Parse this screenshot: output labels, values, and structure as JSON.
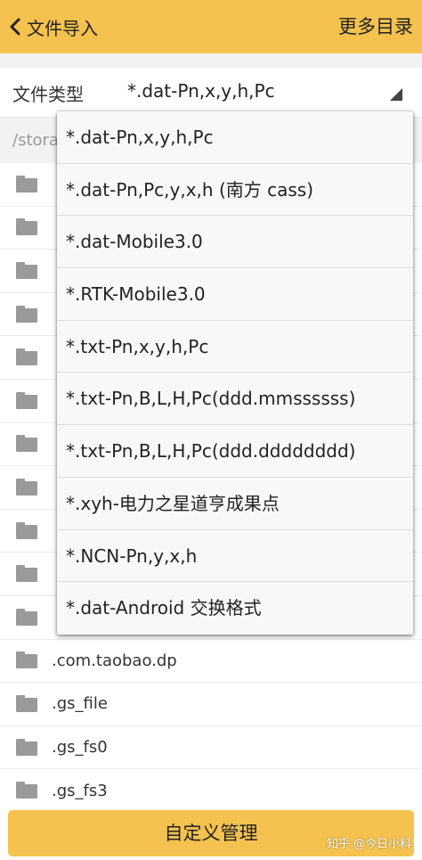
{
  "header": {
    "back_label": "文件导入",
    "more_label": "更多目录",
    "bg_color": "#f5c24f"
  },
  "file_type": {
    "label": "文件类型",
    "selected": "*.dat-Pn,x,y,h,Pc"
  },
  "path": {
    "text": "/stora"
  },
  "file_list": [
    {
      "name": ""
    },
    {
      "name": ""
    },
    {
      "name": ""
    },
    {
      "name": ""
    },
    {
      "name": ""
    },
    {
      "name": ""
    },
    {
      "name": ""
    },
    {
      "name": ""
    },
    {
      "name": ""
    },
    {
      "name": ""
    },
    {
      "name": ""
    },
    {
      "name": ".com.taobao.dp"
    },
    {
      "name": ".gs_file"
    },
    {
      "name": ".gs_fs0"
    },
    {
      "name": ".gs_fs3"
    }
  ],
  "dropdown": {
    "options": [
      "*.dat-Pn,x,y,h,Pc",
      "*.dat-Pn,Pc,y,x,h (南方 cass)",
      "*.dat-Mobile3.0",
      "*.RTK-Mobile3.0",
      "*.txt-Pn,x,y,h,Pc",
      "*.txt-Pn,B,L,H,Pc(ddd.mmssssss)",
      "*.txt-Pn,B,L,H,Pc(ddd.dddddddd)",
      "*.xyh-电力之星道亨成果点",
      "*.NCN-Pn,y,x,h",
      "*.dat-Android 交换格式"
    ]
  },
  "bottom": {
    "button_label": "自定义管理"
  },
  "watermark": {
    "text": "知乎 @今日小科"
  },
  "icons": {
    "back": "chevron-left-icon",
    "dropdown_arrow": "triangle-down-icon",
    "folder": "folder-icon"
  }
}
